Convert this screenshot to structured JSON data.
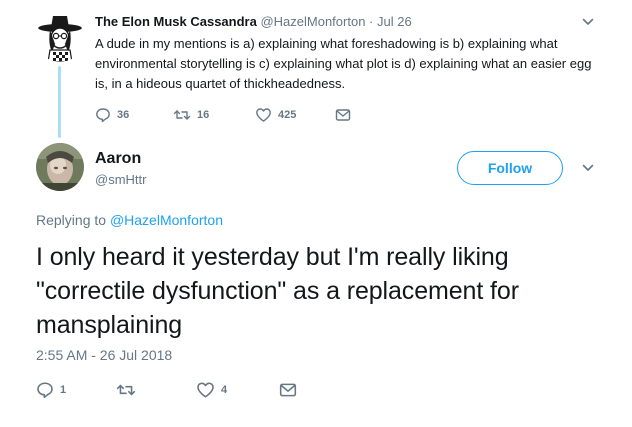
{
  "parent_tweet": {
    "display_name": "The Elon Musk Cassandra",
    "handle": "@HazelMonforton",
    "separator": "·",
    "date": "Jul 26",
    "text": "A dude in my mentions is a) explaining what foreshadowing is b) explaining what environmental storytelling is c) explaining what plot is d) explaining what an easier egg is, in a hideous quartet of thickheadedness.",
    "replies": "36",
    "retweets": "16",
    "likes": "425"
  },
  "main_tweet": {
    "display_name": "Aaron",
    "handle": "@smHttr",
    "follow_label": "Follow",
    "replying_prefix": "Replying to",
    "replying_mention": "@HazelMonforton",
    "text": "I only heard it yesterday but I'm really liking \"correctile dysfunction\" as a replacement for mansplaining",
    "timestamp": "2:55 AM - 26 Jul 2018",
    "replies": "1",
    "retweets": "",
    "likes": "4"
  },
  "icons": {
    "reply": "reply-icon",
    "retweet": "retweet-icon",
    "like": "heart-icon",
    "dm": "envelope-icon",
    "caret": "chevron-down-icon"
  },
  "colors": {
    "accent": "#1da1f2",
    "muted": "#657786",
    "text": "#14171a",
    "thread_line": "#a8dff5"
  }
}
